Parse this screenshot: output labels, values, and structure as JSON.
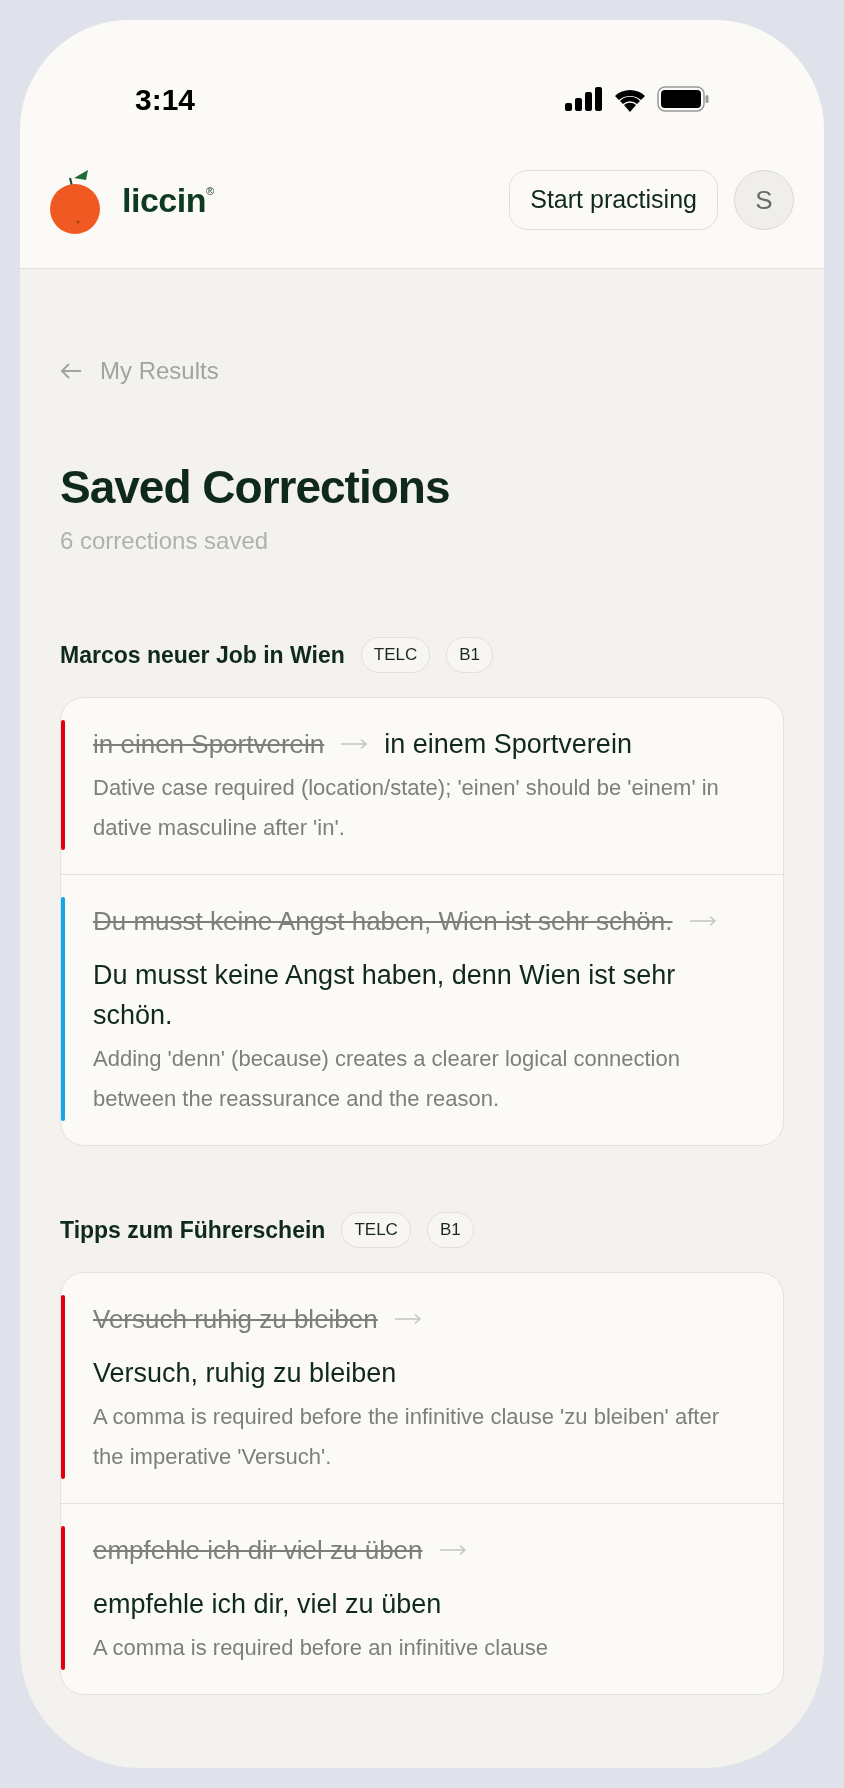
{
  "status_bar": {
    "time": "3:14"
  },
  "header": {
    "brand": "liccin",
    "brand_mark": "®",
    "cta": "Start practising",
    "avatar": "S"
  },
  "back_link": "My Results",
  "title": "Saved Corrections",
  "subtitle": "6 corrections saved",
  "sections": [
    {
      "title": "Marcos neuer Job in Wien",
      "tags": [
        "TELC",
        "B1"
      ],
      "corrections": [
        {
          "original": "in einen Sportverein",
          "corrected": "in einem Sportverein",
          "explanation": "Dative case required (location/state); 'einen' should be 'einem' in dative masculine after 'in'.",
          "color": "#e1000f"
        },
        {
          "original": "Du musst keine Angst haben, Wien ist sehr schön.",
          "corrected": "Du musst keine Angst haben, denn Wien ist sehr schön.",
          "explanation": "Adding 'denn' (because) creates a clearer logical connection between the reassurance and the reason.",
          "color": "#12a6e8"
        }
      ]
    },
    {
      "title": "Tipps zum Führerschein",
      "tags": [
        "TELC",
        "B1"
      ],
      "corrections": [
        {
          "original": "Versuch ruhig zu bleiben",
          "corrected": "Versuch, ruhig zu bleiben",
          "explanation": "A comma is required before the infinitive clause 'zu bleiben' after the imperative 'Versuch'.",
          "color": "#e1000f"
        },
        {
          "original": "empfehle ich dir viel zu üben",
          "corrected": "empfehle ich dir, viel zu üben",
          "explanation": "A comma is required before an infinitive clause",
          "color": "#e1000f"
        }
      ]
    }
  ]
}
